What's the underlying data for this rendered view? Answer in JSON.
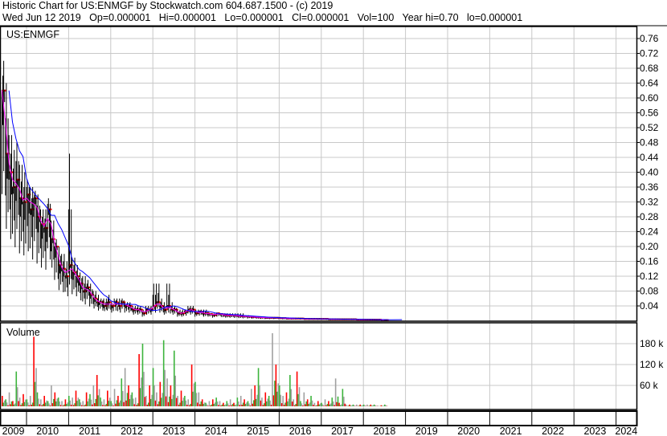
{
  "header": {
    "title": "Historic Chart for US:ENMGF by Stockwatch.com 604.687.1500 - (c) 2019",
    "quote": "Wed Jun 12 2019   Op=0.000001   Hi=0.000001   Lo=0.000001   Cl=0.000001   Vol=100   Year hi=0.70   lo=0.000001"
  },
  "chart_data": [
    {
      "type": "line",
      "title": "US:ENMGF",
      "start": "2009-06",
      "interval": "month",
      "y_ticks": [
        0.04,
        0.08,
        0.12,
        0.16,
        0.2,
        0.24,
        0.28,
        0.32,
        0.36,
        0.4,
        0.44,
        0.48,
        0.52,
        0.56,
        0.6,
        0.64,
        0.68,
        0.72,
        0.76
      ],
      "ylim": [
        0,
        0.78
      ],
      "close": [
        0.62,
        0.45,
        0.4,
        0.36,
        0.38,
        0.33,
        0.32,
        0.34,
        0.3,
        0.33,
        0.28,
        0.26,
        0.25,
        0.3,
        0.22,
        0.2,
        0.15,
        0.14,
        0.12,
        0.15,
        0.13,
        0.12,
        0.1,
        0.08,
        0.09,
        0.07,
        0.06,
        0.05,
        0.05,
        0.04,
        0.05,
        0.04,
        0.05,
        0.04,
        0.05,
        0.04,
        0.04,
        0.03,
        0.03,
        0.03,
        0.02,
        0.03,
        0.03,
        0.04,
        0.05,
        0.04,
        0.03,
        0.04,
        0.03,
        0.03,
        0.02,
        0.02,
        0.025,
        0.03,
        0.03,
        0.02,
        0.025,
        0.02,
        0.02,
        0.018,
        0.015,
        0.02,
        0.018,
        0.015,
        0.014,
        0.015,
        0.014,
        0.013,
        0.012,
        0.012,
        0.011,
        0.01,
        0.01,
        0.009,
        0.009,
        0.008,
        0.008,
        0.008,
        0.008,
        0.007,
        0.007,
        0.006,
        0.006,
        0.006,
        0.006,
        0.006,
        0.005,
        0.005,
        0.005,
        0.005,
        0.005,
        0.005,
        0.005,
        0.004,
        0.004,
        0.004,
        0.004,
        0.004,
        0.004,
        0.004,
        0.004,
        0.003,
        0.003,
        0.003,
        0.003,
        0.003,
        0.003,
        0.003,
        0.002,
        0.002
      ],
      "high": [
        0.7,
        0.64,
        0.5,
        0.46,
        0.48,
        0.42,
        0.4,
        0.38,
        0.36,
        0.35,
        0.34,
        0.3,
        0.3,
        0.33,
        0.27,
        0.22,
        0.2,
        0.18,
        0.16,
        0.45,
        0.17,
        0.15,
        0.13,
        0.12,
        0.11,
        0.1,
        0.08,
        0.07,
        0.06,
        0.06,
        0.07,
        0.05,
        0.06,
        0.06,
        0.06,
        0.05,
        0.05,
        0.04,
        0.04,
        0.04,
        0.03,
        0.04,
        0.04,
        0.1,
        0.1,
        0.06,
        0.05,
        0.1,
        0.05,
        0.04,
        0.03,
        0.03,
        0.03,
        0.04,
        0.04,
        0.03,
        0.03,
        0.03,
        0.03,
        0.02,
        0.02,
        0.02,
        0.02,
        0.02,
        0.02,
        0.02,
        0.02,
        0.02,
        0.02,
        0.015,
        0.015,
        0.012,
        0.012,
        0.012,
        0.01,
        0.01,
        0.01,
        0.01,
        0.01,
        0.01,
        0.009,
        0.009,
        0.008,
        0.008,
        0.008,
        0.008,
        0.007,
        0.007,
        0.007,
        0.007,
        0.007,
        0.006,
        0.006,
        0.006,
        0.006,
        0.006,
        0.005,
        0.005,
        0.005,
        0.005,
        0.005,
        0.005,
        0.004,
        0.004,
        0.004,
        0.004,
        0.004,
        0.004,
        0.003,
        0.003
      ],
      "ma_short_color": "#ff00ff",
      "ma_long_color": "#0000ff"
    },
    {
      "type": "bar",
      "title": "Volume",
      "y_ticks": [
        60,
        120,
        180
      ],
      "y_tick_labels": [
        "60 k",
        "120 k",
        "180 k"
      ],
      "ylim": [
        0,
        230
      ],
      "volume_k": [
        30,
        20,
        40,
        15,
        100,
        25,
        35,
        20,
        30,
        200,
        40,
        20,
        30,
        15,
        60,
        40,
        25,
        15,
        20,
        30,
        25,
        45,
        20,
        15,
        40,
        35,
        60,
        90,
        25,
        20,
        45,
        15,
        50,
        30,
        80,
        110,
        60,
        40,
        25,
        150,
        180,
        30,
        60,
        110,
        40,
        70,
        190,
        80,
        60,
        160,
        30,
        45,
        30,
        20,
        120,
        70,
        40,
        20,
        10,
        15,
        20,
        25,
        15,
        10,
        15,
        20,
        10,
        25,
        30,
        20,
        15,
        50,
        60,
        110,
        25,
        40,
        30,
        210,
        120,
        60,
        30,
        40,
        90,
        20,
        100,
        15,
        40,
        20,
        30,
        10,
        15,
        10,
        20,
        15,
        25,
        80,
        10,
        50,
        5,
        5,
        5,
        5,
        5,
        5,
        5,
        5,
        5,
        2,
        3,
        5
      ]
    },
    {
      "x_tick_labels": [
        "2009",
        "2010",
        "2011",
        "2012",
        "2013",
        "2014",
        "2015",
        "2016",
        "2017",
        "2018",
        "2019",
        "2020",
        "2021",
        "2022",
        "2023",
        "2024"
      ]
    }
  ]
}
